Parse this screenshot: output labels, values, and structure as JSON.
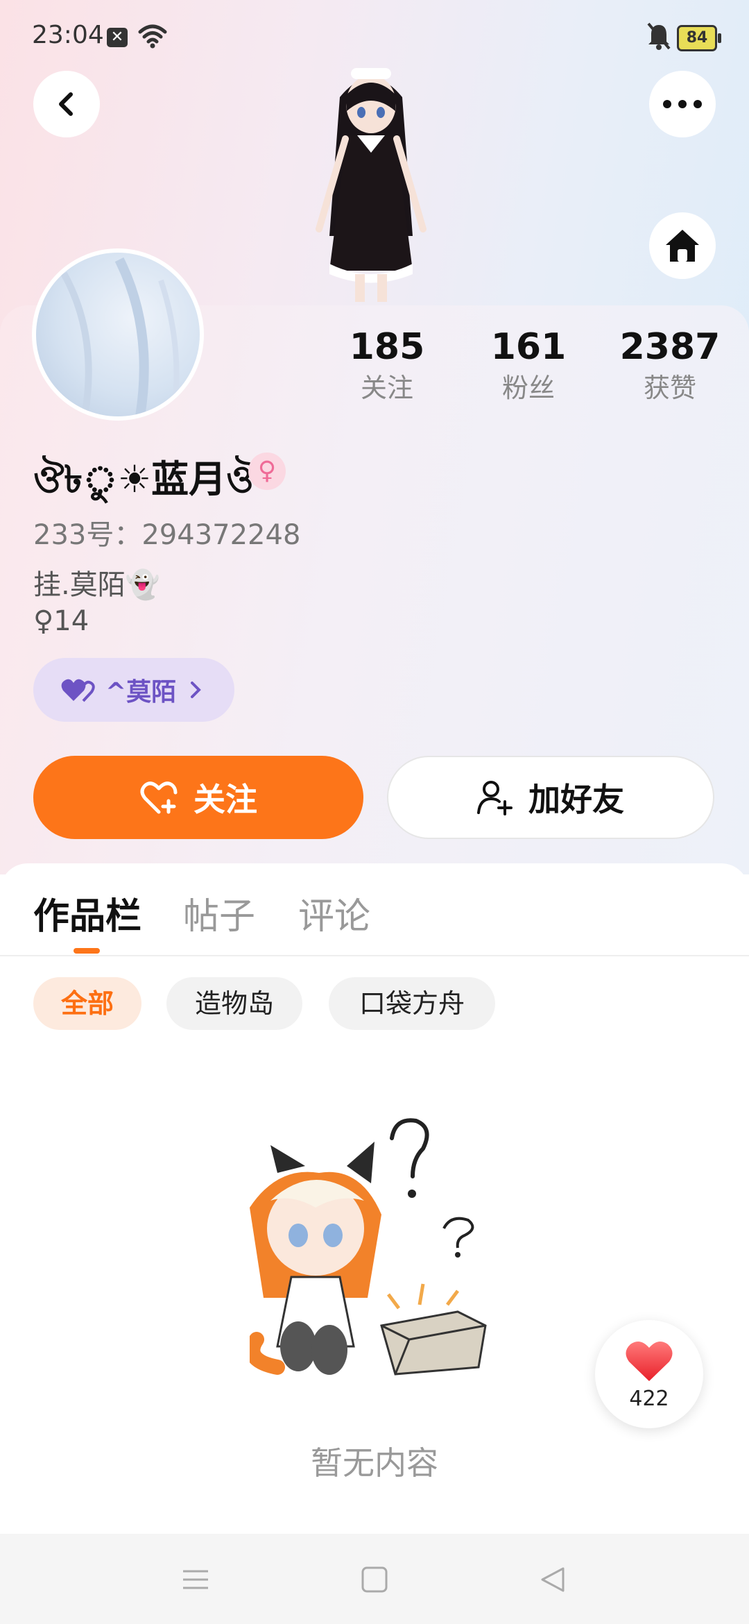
{
  "status_bar": {
    "time": "23:04",
    "battery": "84"
  },
  "profile": {
    "stats": [
      {
        "num": "185",
        "label": "关注"
      },
      {
        "num": "161",
        "label": "粉丝"
      },
      {
        "num": "2387",
        "label": "获赞"
      }
    ],
    "username": "ঔ৳ু☀蓝月ঔ",
    "gender_icon": "female-icon",
    "uid": "233号：294372248",
    "bio_line1": "挂.莫陌👻",
    "bio_line2": "♀14",
    "relation_pill": "^莫陌"
  },
  "actions": {
    "follow": "关注",
    "add_friend": "加好友"
  },
  "tabs": [
    "作品栏",
    "帖子",
    "评论"
  ],
  "filters": [
    "全部",
    "造物岛",
    "口袋方舟"
  ],
  "empty_text": "暂无内容",
  "like_count": "422",
  "colors": {
    "accent": "#fd7519",
    "pill_bg": "#e6ddf6",
    "pill_text": "#6d53c4"
  }
}
